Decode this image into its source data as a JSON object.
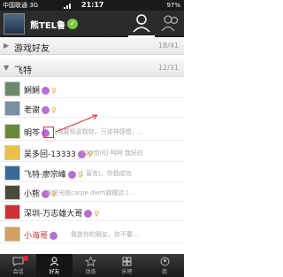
{
  "status_bar": {
    "carrier": "中国联通 3G",
    "time": "21:17",
    "battery": "97%"
  },
  "header": {
    "name": "熊TEL鲁",
    "check": "✓"
  },
  "groups": [
    {
      "name": "游戏好友",
      "count": "18/41"
    },
    {
      "name": "飞特",
      "count": "12/31"
    }
  ],
  "friends": [
    {
      "name": "娴娴",
      "status": "",
      "sex": "♀"
    },
    {
      "name": "老谢",
      "status": "",
      "sex": "♀"
    },
    {
      "name": "明芩",
      "status": "[我要知这我你，只这样感想，...",
      "sex": ""
    },
    {
      "name": "吴多回-13333",
      "status": "[QQ空间] 呵呵 我好的",
      "sex": "♀"
    },
    {
      "name": "飞特·廖宗峰",
      "status": "[ 留言]，你我成功",
      "sex": "♀"
    },
    {
      "name": "小熊",
      "status": "欢迎光临carpe diem旗舰店 [...",
      "sex": "♀"
    },
    {
      "name": "深圳-万志雄大哥",
      "status": "",
      "sex": "♀"
    },
    {
      "name": "小海哥",
      "status": "我是你的朋友，你不要...",
      "sex": ""
    }
  ],
  "tabs": [
    {
      "label": "会话",
      "active": false
    },
    {
      "label": "好友",
      "active": true
    },
    {
      "label": "动态",
      "active": false
    },
    {
      "label": "乐吧",
      "active": false
    },
    {
      "label": "我",
      "active": false
    }
  ],
  "colors": {
    "header_bg": "#2b2b2b",
    "accent_green": "#7ac943",
    "badge_purple": "#b86fd0",
    "status_red": "#cc3333"
  }
}
